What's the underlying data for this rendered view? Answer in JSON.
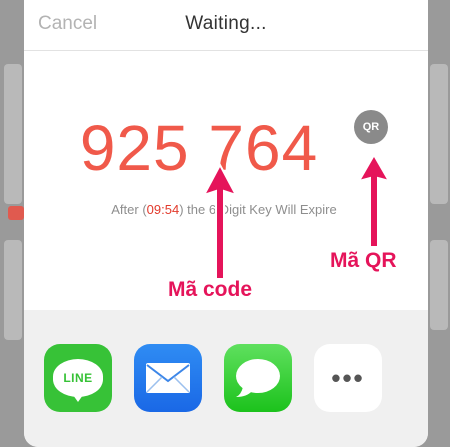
{
  "header": {
    "cancel_label": "Cancel",
    "title": "Waiting..."
  },
  "key": {
    "code": "925 764",
    "qr_label": "QR",
    "expire_prefix": "After (",
    "timer": "09:54",
    "expire_suffix": ") the 6 Digit Key Will Expire"
  },
  "share": {
    "apps": [
      {
        "name": "LINE",
        "icon": "line-icon"
      },
      {
        "name": "Mail",
        "icon": "mail-icon"
      },
      {
        "name": "Messages",
        "icon": "messages-icon"
      },
      {
        "name": "More",
        "icon": "more-icon"
      }
    ],
    "line_text": "LINE",
    "more_text": "•••"
  },
  "annotations": {
    "code_label": "Mã code",
    "qr_label": "Mã QR",
    "color": "#e5145a"
  },
  "colors": {
    "code": "#f0594a",
    "timer": "#e23a2c",
    "line": "#37c237",
    "mail": "#1a68e6",
    "messages": "#1cc21c"
  }
}
